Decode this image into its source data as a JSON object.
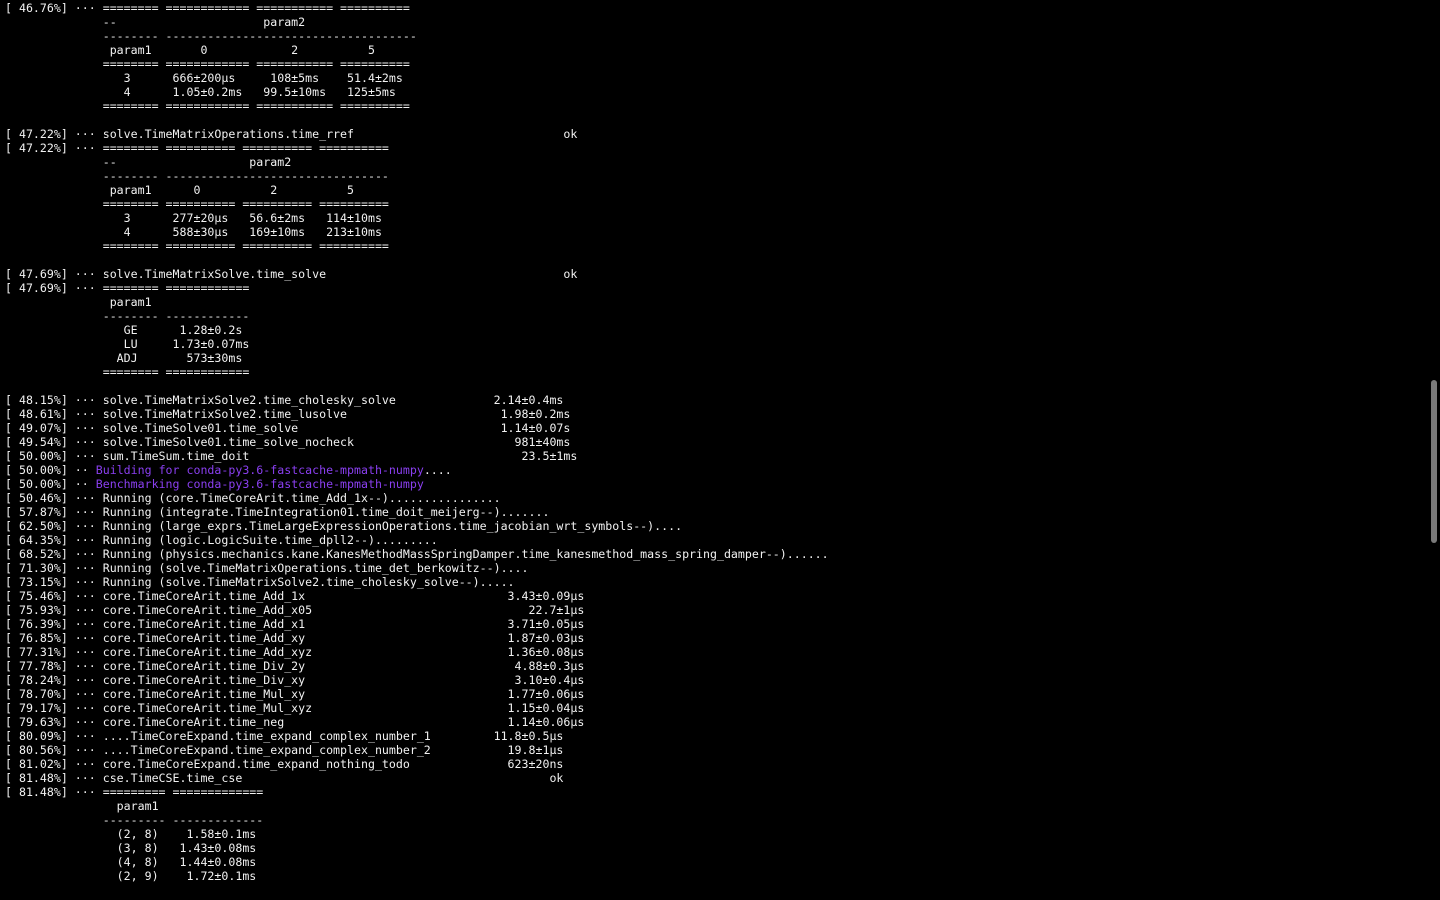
{
  "terminal": {
    "lines": [
      {
        "text": "[ 46.76%] ··· ======== ============ =========== =========="
      },
      {
        "text": "              --                     param2               "
      },
      {
        "text": "              -------- ------------------------------------"
      },
      {
        "text": "               param1       0            2          5     "
      },
      {
        "text": "              ======== ============ =========== =========="
      },
      {
        "text": "                 3      666±200μs     108±5ms    51.4±2ms "
      },
      {
        "text": "                 4      1.05±0.2ms   99.5±10ms   125±5ms  "
      },
      {
        "text": "              ======== ============ =========== =========="
      },
      {
        "text": ""
      },
      {
        "text": "[ 47.22%] ··· solve.TimeMatrixOperations.time_rref                              ok"
      },
      {
        "text": "[ 47.22%] ··· ======== ========== ========== =========="
      },
      {
        "text": "              --                   param2              "
      },
      {
        "text": "              -------- --------------------------------"
      },
      {
        "text": "               param1      0          2          5     "
      },
      {
        "text": "              ======== ========== ========== =========="
      },
      {
        "text": "                 3      277±20μs   56.6±2ms   114±10ms "
      },
      {
        "text": "                 4      588±30μs   169±10ms   213±10ms "
      },
      {
        "text": "              ======== ========== ========== =========="
      },
      {
        "text": ""
      },
      {
        "text": "[ 47.69%] ··· solve.TimeMatrixSolve.time_solve                                  ok"
      },
      {
        "text": "[ 47.69%] ··· ======== ============"
      },
      {
        "text": "               param1              "
      },
      {
        "text": "              -------- ------------"
      },
      {
        "text": "                 GE      1.28±0.2s  "
      },
      {
        "text": "                 LU     1.73±0.07ms "
      },
      {
        "text": "                ADJ       573±30ms  "
      },
      {
        "text": "              ======== ============"
      },
      {
        "text": ""
      },
      {
        "text": "[ 48.15%] ··· solve.TimeMatrixSolve2.time_cholesky_solve              2.14±0.4ms"
      },
      {
        "text": "[ 48.61%] ··· solve.TimeMatrixSolve2.time_lusolve                      1.98±0.2ms"
      },
      {
        "text": "[ 49.07%] ··· solve.TimeSolve01.time_solve                             1.14±0.07s"
      },
      {
        "text": "[ 49.54%] ··· solve.TimeSolve01.time_solve_nocheck                       981±40ms"
      },
      {
        "text": "[ 50.00%] ··· sum.TimeSum.time_doit                                       23.5±1ms"
      },
      {
        "pre": "[ 50.00%] ·· ",
        "purple": "Building for conda-py3.6-fastcache-mpmath-numpy",
        "post": "...."
      },
      {
        "pre": "[ 50.00%] ·· ",
        "purple": "Benchmarking conda-py3.6-fastcache-mpmath-numpy",
        "post": ""
      },
      {
        "text": "[ 50.46%] ··· Running (core.TimeCoreArit.time_Add_1x--)................"
      },
      {
        "text": "[ 57.87%] ··· Running (integrate.TimeIntegration01.time_doit_meijerg--)......."
      },
      {
        "text": "[ 62.50%] ··· Running (large_exprs.TimeLargeExpressionOperations.time_jacobian_wrt_symbols--)...."
      },
      {
        "text": "[ 64.35%] ··· Running (logic.LogicSuite.time_dpll2--)........."
      },
      {
        "text": "[ 68.52%] ··· Running (physics.mechanics.kane.KanesMethodMassSpringDamper.time_kanesmethod_mass_spring_damper--)......"
      },
      {
        "text": "[ 71.30%] ··· Running (solve.TimeMatrixOperations.time_det_berkowitz--)...."
      },
      {
        "text": "[ 73.15%] ··· Running (solve.TimeMatrixSolve2.time_cholesky_solve--)....."
      },
      {
        "text": "[ 75.46%] ··· core.TimeCoreArit.time_Add_1x                             3.43±0.09μs"
      },
      {
        "text": "[ 75.93%] ··· core.TimeCoreArit.time_Add_x05                               22.7±1μs"
      },
      {
        "text": "[ 76.39%] ··· core.TimeCoreArit.time_Add_x1                             3.71±0.05μs"
      },
      {
        "text": "[ 76.85%] ··· core.TimeCoreArit.time_Add_xy                             1.87±0.03μs"
      },
      {
        "text": "[ 77.31%] ··· core.TimeCoreArit.time_Add_xyz                            1.36±0.08μs"
      },
      {
        "text": "[ 77.78%] ··· core.TimeCoreArit.time_Div_2y                              4.88±0.3μs"
      },
      {
        "text": "[ 78.24%] ··· core.TimeCoreArit.time_Div_xy                              3.10±0.4μs"
      },
      {
        "text": "[ 78.70%] ··· core.TimeCoreArit.time_Mul_xy                             1.77±0.06μs"
      },
      {
        "text": "[ 79.17%] ··· core.TimeCoreArit.time_Mul_xyz                            1.15±0.04μs"
      },
      {
        "text": "[ 79.63%] ··· core.TimeCoreArit.time_neg                                1.14±0.06μs"
      },
      {
        "text": "[ 80.09%] ··· ....TimeCoreExpand.time_expand_complex_number_1         11.8±0.5μs"
      },
      {
        "text": "[ 80.56%] ··· ....TimeCoreExpand.time_expand_complex_number_2           19.8±1μs"
      },
      {
        "text": "[ 81.02%] ··· core.TimeCoreExpand.time_expand_nothing_todo              623±20ns"
      },
      {
        "text": "[ 81.48%] ··· cse.TimeCSE.time_cse                                            ok"
      },
      {
        "text": "[ 81.48%] ··· ========= ============="
      },
      {
        "text": "                param1               "
      },
      {
        "text": "              --------- -------------"
      },
      {
        "text": "                (2, 8)    1.58±0.1ms "
      },
      {
        "text": "                (3, 8)   1.43±0.08ms "
      },
      {
        "text": "                (4, 8)   1.44±0.08ms "
      },
      {
        "text": "                (2, 9)    1.72±0.1ms "
      }
    ]
  },
  "colors": {
    "background": "#000000",
    "text": "#f2f2f2",
    "highlight": "#8a3ff0",
    "scrollbar": "#7a7a7a"
  }
}
